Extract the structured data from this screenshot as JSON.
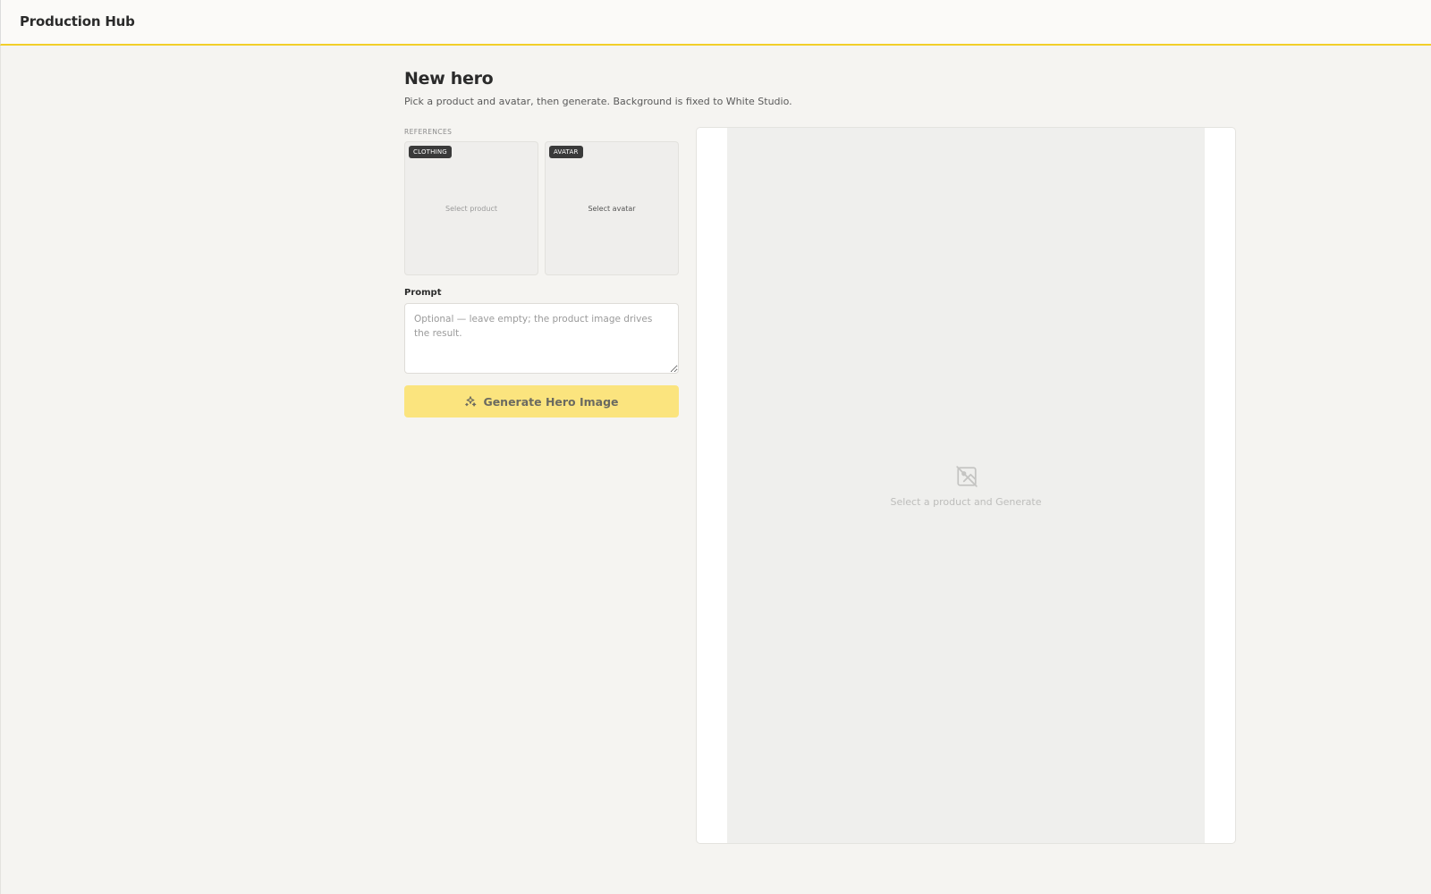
{
  "header": {
    "app_title": "Production Hub",
    "accent_color": "#f2cf2a"
  },
  "page": {
    "title": "New hero",
    "subtitle": "Pick a product and avatar, then generate. Background is fixed to White Studio."
  },
  "references": {
    "section_label": "REFERENCES",
    "product": {
      "badge": "CLOTHING",
      "label": "Select product"
    },
    "avatar": {
      "badge": "AVATAR",
      "label": "Select avatar"
    }
  },
  "prompt": {
    "label": "Prompt",
    "value": "",
    "placeholder": "Optional — leave empty; the product image drives the result."
  },
  "actions": {
    "generate_label": "Generate Hero Image",
    "generate_icon": "sparkles-icon",
    "button_color": "#fbe47e"
  },
  "preview": {
    "empty_icon": "image-off-icon",
    "empty_text": "Select a product and Generate"
  }
}
